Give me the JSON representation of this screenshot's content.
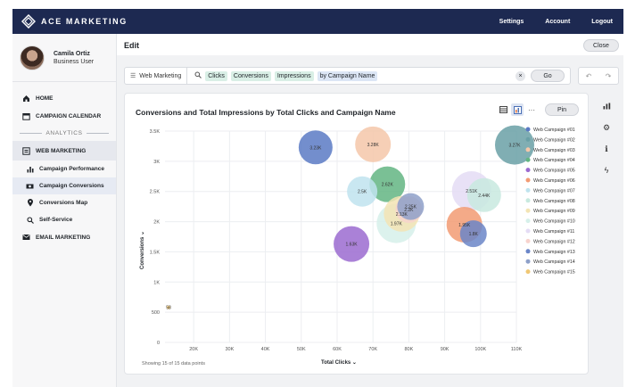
{
  "brand": {
    "name": "ACE MARKETING",
    "icon": "diamond-logo-icon"
  },
  "topnav": {
    "settings": "Settings",
    "account": "Account",
    "logout": "Logout"
  },
  "user": {
    "name": "Camila Ortiz",
    "role": "Business User"
  },
  "nav": {
    "home": "HOME",
    "calendar": "CAMPAIGN CALENDAR",
    "section": "ANALYTICS",
    "web_marketing": "WEB MARKETING",
    "sub": [
      "Campaign Performance",
      "Campaign Conversions",
      "Conversions Map",
      "Self-Service"
    ],
    "email": "EMAIL MARKETING"
  },
  "header": {
    "title": "Edit",
    "close": "Close"
  },
  "query": {
    "source": "Web Marketing",
    "chips": [
      "Clicks",
      "Conversions",
      "Impressions",
      "by Campaign Name"
    ],
    "go": "Go"
  },
  "card": {
    "pin": "Pin",
    "footnote": "Showing 15 of 15 data points"
  },
  "chart_data": {
    "type": "scatter",
    "title": "Conversions and Total Impressions by Total Clicks and Campaign Name",
    "xlabel": "Total Clicks",
    "ylabel": "Conversions",
    "xlim": [
      12000,
      110000
    ],
    "ylim": [
      0,
      3500
    ],
    "xticks": [
      20000,
      30000,
      40000,
      50000,
      60000,
      70000,
      80000,
      90000,
      100000,
      110000
    ],
    "xtick_labels": [
      "20K",
      "30K",
      "40K",
      "50K",
      "60K",
      "70K",
      "80K",
      "90K",
      "100K",
      "110K"
    ],
    "yticks": [
      0,
      500,
      1000,
      1500,
      2000,
      2500,
      3000,
      3500
    ],
    "ytick_labels": [
      "0",
      "500",
      "1K",
      "1.5K",
      "2K",
      "2.5K",
      "3K",
      "3.5K"
    ],
    "legend_position": "right",
    "series": [
      {
        "name": "Web Campaign #01",
        "color": "#5b7ac4",
        "x": 54000,
        "y": 3230,
        "size": 19,
        "label": "3.23K"
      },
      {
        "name": "Web Campaign #02",
        "color": "#6aa0a6",
        "x": 109500,
        "y": 3270,
        "size": 22,
        "label": "3.27K"
      },
      {
        "name": "Web Campaign #03",
        "color": "#f5c7a9",
        "x": 70000,
        "y": 3280,
        "size": 20,
        "label": "3.28K"
      },
      {
        "name": "Web Campaign #04",
        "color": "#63b583",
        "x": 74000,
        "y": 2620,
        "size": 20,
        "label": "2.62K"
      },
      {
        "name": "Web Campaign #05",
        "color": "#9b6bd0",
        "x": 64000,
        "y": 1630,
        "size": 20,
        "label": "1.63K"
      },
      {
        "name": "Web Campaign #06",
        "color": "#f29b73",
        "x": 95500,
        "y": 1950,
        "size": 20,
        "label": "1.95K"
      },
      {
        "name": "Web Campaign #07",
        "color": "#bfe3ee",
        "x": 67000,
        "y": 2500,
        "size": 17,
        "label": "2.5K"
      },
      {
        "name": "Web Campaign #08",
        "color": "#c8e9df",
        "x": 101000,
        "y": 2440,
        "size": 19,
        "label": "2.44K"
      },
      {
        "name": "Web Campaign #09",
        "color": "#f3e4b4",
        "x": 78000,
        "y": 2130,
        "size": 20,
        "label": "2.13K"
      },
      {
        "name": "Web Campaign #10",
        "color": "#d6f0ea",
        "x": 76500,
        "y": 1970,
        "size": 22,
        "label": "1.97K"
      },
      {
        "name": "Web Campaign #11",
        "color": "#e4dcf5",
        "x": 97500,
        "y": 2510,
        "size": 22,
        "label": "2.51K"
      },
      {
        "name": "Web Campaign #12",
        "color": "#f7d3cd",
        "x": 80000,
        "y": 2200,
        "size": 15,
        "label": "2.2K"
      },
      {
        "name": "Web Campaign #13",
        "color": "#6b86c8",
        "x": 98000,
        "y": 1800,
        "size": 15,
        "label": "1.8K"
      },
      {
        "name": "Web Campaign #14",
        "color": "#8ea0c9",
        "x": 80500,
        "y": 2250,
        "size": 15,
        "label": "2.25K"
      },
      {
        "name": "Web Campaign #15",
        "color": "#f0c774",
        "x": 13000,
        "y": 580,
        "size": 2,
        "label": "58"
      }
    ]
  },
  "icons": {
    "table_view": "table-icon",
    "chart_view": "chart-icon",
    "more": "more-icon",
    "rail": [
      "bar-chart-icon",
      "gear-icon",
      "info-icon",
      "lightning-icon"
    ]
  }
}
